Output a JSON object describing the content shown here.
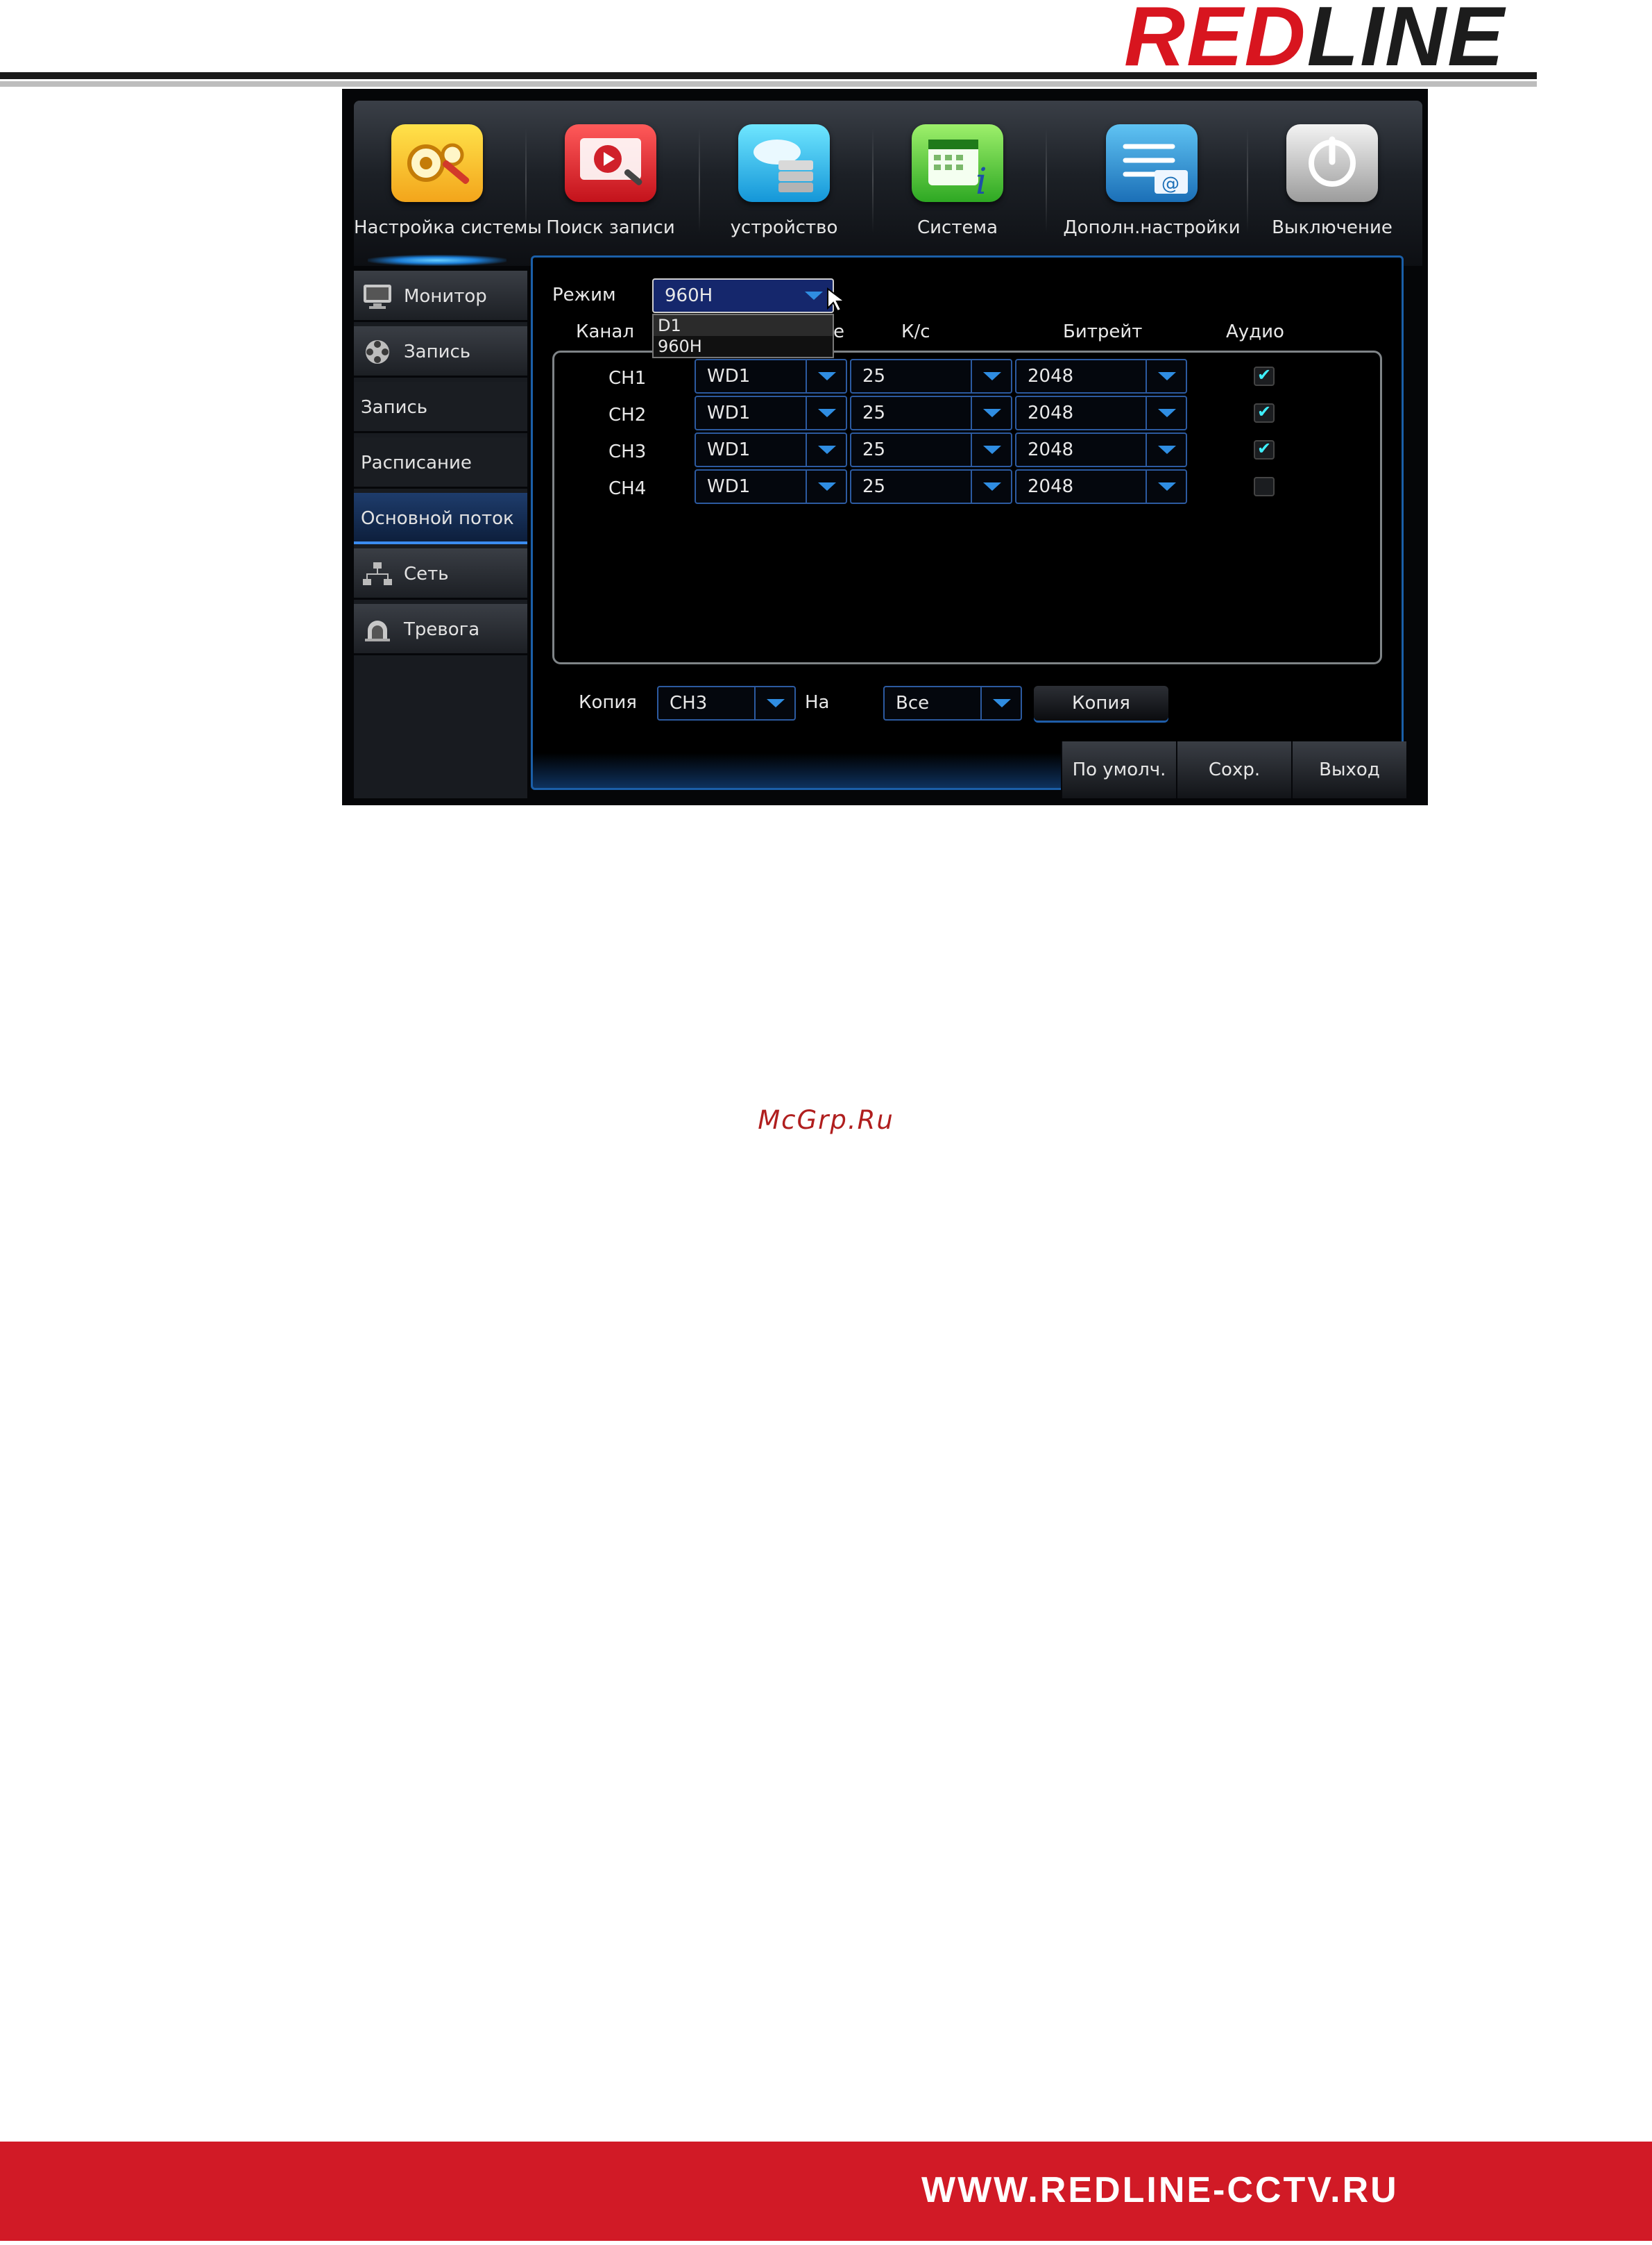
{
  "brand": {
    "part1": "RED",
    "part2": "LINE"
  },
  "watermark": "McGrp.Ru",
  "footer_url": "WWW.REDLINE-CCTV.RU",
  "dvr": {
    "top_tabs": [
      {
        "label": "Настройка системы",
        "icon": "settings-gears-icon"
      },
      {
        "label": "Поиск записи",
        "icon": "video-search-icon"
      },
      {
        "label": "устройство",
        "icon": "storage-device-icon"
      },
      {
        "label": "Система",
        "icon": "calendar-info-icon"
      },
      {
        "label": "Дополн.настройки",
        "icon": "advanced-settings-icon"
      },
      {
        "label": "Выключение",
        "icon": "power-icon"
      }
    ],
    "sidebar": [
      {
        "label": "Монитор",
        "icon": "monitor-icon"
      },
      {
        "label": "Запись",
        "icon": "film-reel-icon"
      },
      {
        "label": "Запись"
      },
      {
        "label": "Расписание записи"
      },
      {
        "label": "Основной поток"
      },
      {
        "label": "Сеть",
        "icon": "network-icon"
      },
      {
        "label": "Тревога",
        "icon": "alarm-icon"
      }
    ],
    "mode": {
      "label": "Режим",
      "value": "960H",
      "options": [
        "D1",
        "960H"
      ]
    },
    "columns": {
      "channel": "Канал",
      "resolution_tail": "е",
      "fps": "К/с",
      "bitrate": "Битрейт",
      "audio": "Аудио"
    },
    "rows": [
      {
        "channel": "CH1",
        "resolution": "WD1",
        "fps": "25",
        "bitrate": "2048",
        "audio": true
      },
      {
        "channel": "CH2",
        "resolution": "WD1",
        "fps": "25",
        "bitrate": "2048",
        "audio": true
      },
      {
        "channel": "CH3",
        "resolution": "WD1",
        "fps": "25",
        "bitrate": "2048",
        "audio": true
      },
      {
        "channel": "CH4",
        "resolution": "WD1",
        "fps": "25",
        "bitrate": "2048",
        "audio": false
      }
    ],
    "copy": {
      "label": "Копия",
      "source": "CH3",
      "to_label": "На",
      "target": "Все",
      "button": "Копия"
    },
    "buttons": {
      "default": "По умолч.",
      "save": "Сохр.",
      "exit": "Выход"
    }
  }
}
